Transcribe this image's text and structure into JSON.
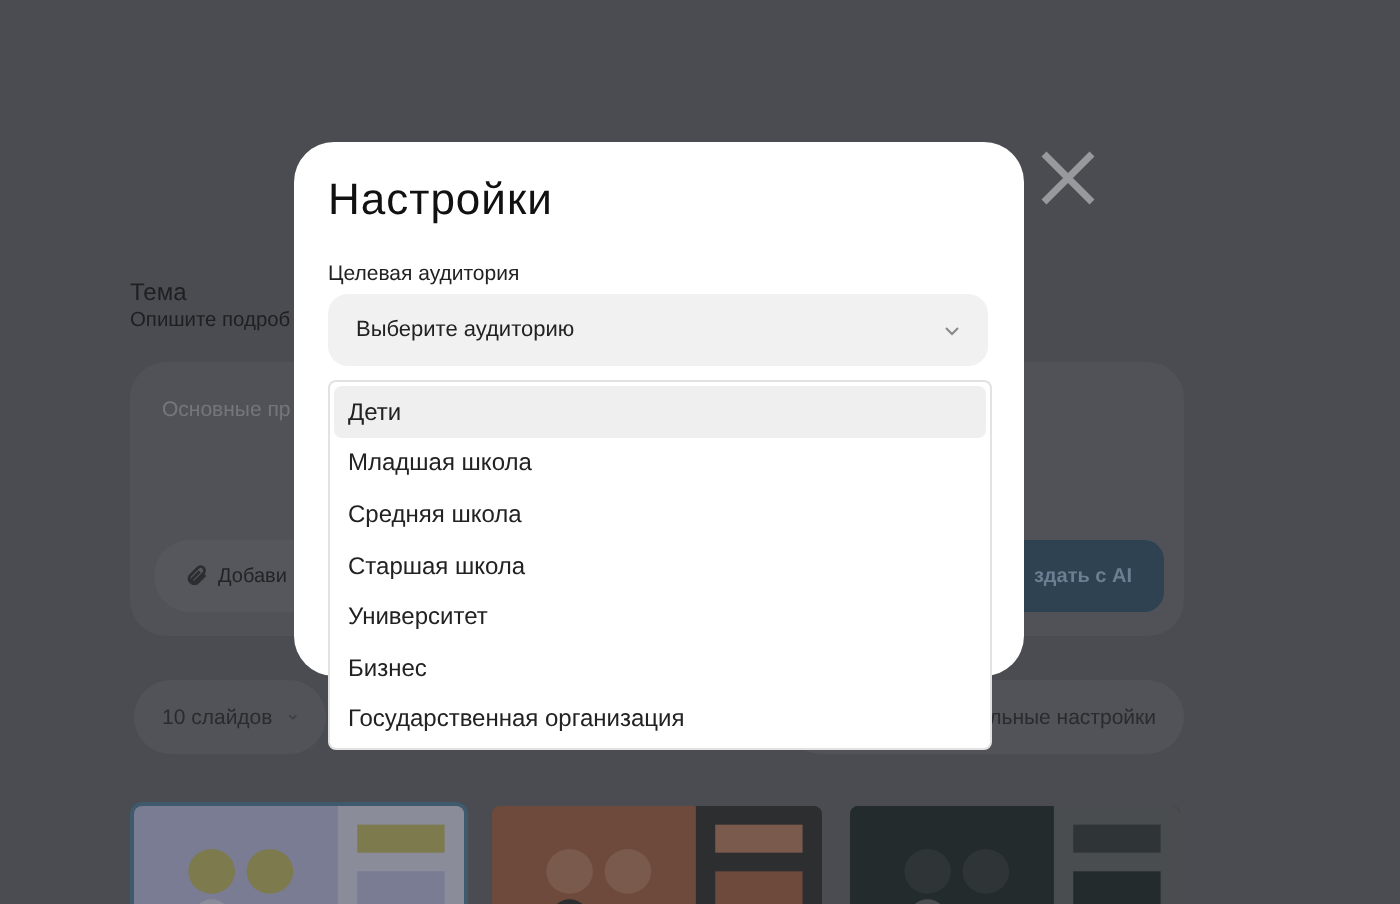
{
  "background": {
    "topic_title": "Тема",
    "topic_hint": "Опишите подроб",
    "topic_placeholder": "Основные пр",
    "attach_button": "Добави",
    "create_button": "здать с AI",
    "slides_select": "10 слайдов",
    "settings_button": "льные настройки",
    "thumbnails": [
      {
        "kind": "picture",
        "selected": true
      },
      {
        "kind": "picture",
        "selected": false
      },
      {
        "kind": "picture",
        "selected": false
      }
    ]
  },
  "modal": {
    "title": "Настройки",
    "field_label": "Целевая аудитория",
    "select_placeholder": "Выберите аудиторию",
    "options": [
      {
        "label": "Дети",
        "selected": true
      },
      {
        "label": "Младшая школа",
        "selected": false
      },
      {
        "label": "Средняя школа",
        "selected": false
      },
      {
        "label": "Старшая школа",
        "selected": false
      },
      {
        "label": "Университет",
        "selected": false
      },
      {
        "label": "Бизнес",
        "selected": false
      },
      {
        "label": "Государственная организация",
        "selected": false
      }
    ]
  }
}
